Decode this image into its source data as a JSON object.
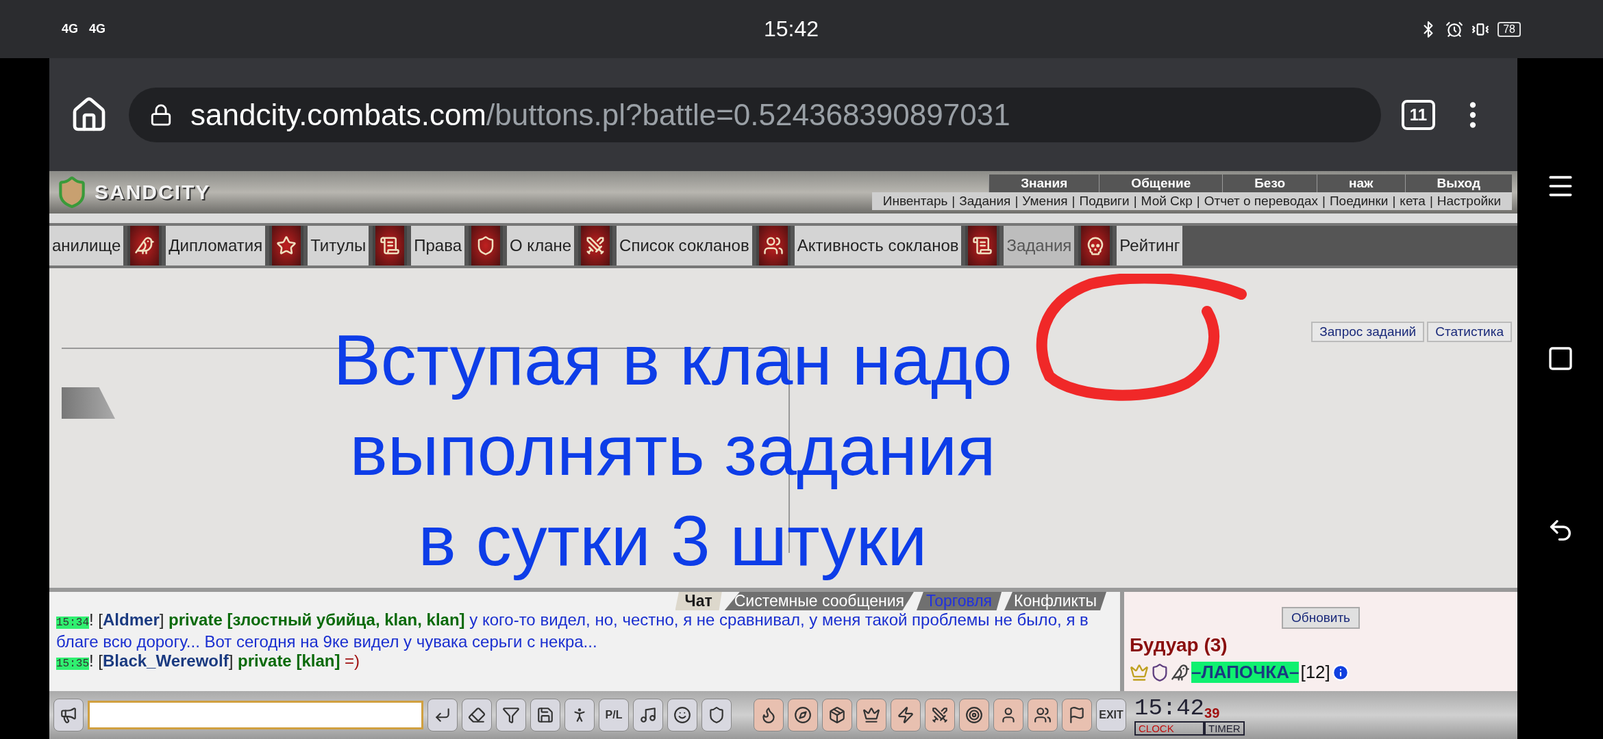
{
  "status_bar": {
    "networks": [
      "4G",
      "4G"
    ],
    "time": "15:42",
    "battery": "78"
  },
  "browser": {
    "url_host": "sandcity.combats.com",
    "url_path": "/buttons.pl?battle=0.524368390897031",
    "tab_count": "11"
  },
  "header": {
    "logo": "SANDCITY",
    "top_menu": [
      "Знания",
      "Общение",
      "Безо",
      "наж",
      "Выход"
    ],
    "separator": "|",
    "sub_menu": [
      "Инвентарь",
      "Задания",
      "Умения",
      "Подвиги",
      "Мой Скр",
      "Отчет о переводах",
      "Поединки",
      "кета",
      "Настройки"
    ]
  },
  "clan_tabs": [
    {
      "label": "анилище",
      "selected": false
    },
    {
      "label": "Дипломатия",
      "selected": false
    },
    {
      "label": "Титулы",
      "selected": false
    },
    {
      "label": "Права",
      "selected": false
    },
    {
      "label": "О клане",
      "selected": false
    },
    {
      "label": "Список сокланов",
      "selected": false
    },
    {
      "label": "Активность сокланов",
      "selected": false
    },
    {
      "label": "Задания",
      "selected": true
    },
    {
      "label": "Рейтинг",
      "selected": false
    }
  ],
  "content_buttons": [
    "Запрос заданий",
    "Статистика"
  ],
  "overlay_text": [
    "Вступая в клан надо",
    "выполнять задания",
    "в сутки 3 штуки"
  ],
  "chat": {
    "tabs": [
      {
        "label": "Чат",
        "selected": true,
        "highlighted": false
      },
      {
        "label": "Системные сообщения",
        "selected": false,
        "highlighted": false
      },
      {
        "label": "Торговля",
        "selected": false,
        "highlighted": true
      },
      {
        "label": "Конфликты",
        "selected": false,
        "highlighted": false
      }
    ],
    "messages": [
      {
        "time": "15:34",
        "prefix": "! [",
        "name": "Aldmer",
        "suffix": "]",
        "private": "private [злостный убийца, klan, klan]",
        "text": "у кого-то видел, но, честно, я не сравнивал, у меня такой проблемы не было, я в благе всю дорогу... Вот сегодня на 9ке видел у чувака серьги с некра...",
        "color": "#1a2fd0"
      },
      {
        "time": "15:35",
        "prefix": "! [",
        "name": "Black_Werewolf",
        "suffix": "]",
        "private": "private [klan]",
        "text": "=)",
        "color": "#a01010"
      }
    ]
  },
  "room": {
    "refresh": "Обновить",
    "title": "Будуар (3)",
    "user": {
      "name": "–ЛАПОЧКА–",
      "level": "[12]"
    }
  },
  "toolbar": {
    "p_l": "P/L",
    "exit": "EXIT",
    "clock": "15:42",
    "seconds": "39",
    "clock_label": "CLOCK",
    "timer_label": "TIMER"
  }
}
